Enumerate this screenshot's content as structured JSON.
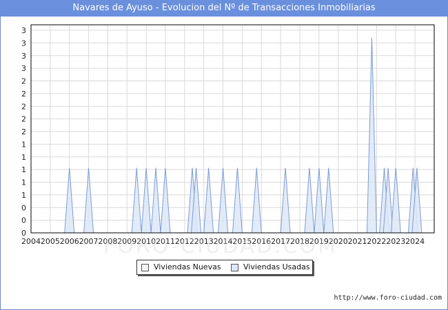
{
  "chart_data": {
    "type": "area",
    "title": "Navares de Ayuso - Evolucion del Nº de Transacciones Inmobiliarias",
    "xlabel": "",
    "ylabel": "",
    "x_tick_labels": [
      "2004",
      "2005",
      "2006",
      "2007",
      "2008",
      "2009",
      "2010",
      "2011",
      "2012",
      "2013",
      "2014",
      "2015",
      "2016",
      "2017",
      "2018",
      "2019",
      "2020",
      "2021",
      "2022",
      "2023",
      "2024"
    ],
    "y_tick_labels": [
      "0",
      "0",
      "0",
      "1",
      "1",
      "1",
      "1",
      "1",
      "2",
      "2",
      "2",
      "2",
      "2",
      "3",
      "3",
      "3",
      "3"
    ],
    "ylim": [
      0,
      3.2
    ],
    "xlim": [
      2004,
      2025
    ],
    "grid": true,
    "legend_position": "bottom",
    "colors": {
      "nuevas": "#f2f2f2",
      "usadas": "#dde7f7",
      "usadas_stroke": "#7c9bd6",
      "grid": "#d9d9d9"
    },
    "series": [
      {
        "name": "Viviendas Nuevas",
        "peaks": []
      },
      {
        "name": "Viviendas Usadas",
        "peaks": [
          {
            "x": 2006.0,
            "y": 1
          },
          {
            "x": 2007.0,
            "y": 1
          },
          {
            "x": 2009.5,
            "y": 1
          },
          {
            "x": 2010.0,
            "y": 1
          },
          {
            "x": 2010.5,
            "y": 1
          },
          {
            "x": 2011.0,
            "y": 1
          },
          {
            "x": 2012.4,
            "y": 1
          },
          {
            "x": 2012.6,
            "y": 1
          },
          {
            "x": 2013.25,
            "y": 1
          },
          {
            "x": 2014.0,
            "y": 1
          },
          {
            "x": 2014.75,
            "y": 1
          },
          {
            "x": 2015.75,
            "y": 1
          },
          {
            "x": 2017.25,
            "y": 1
          },
          {
            "x": 2018.5,
            "y": 1
          },
          {
            "x": 2019.0,
            "y": 1
          },
          {
            "x": 2019.5,
            "y": 1
          },
          {
            "x": 2021.75,
            "y": 3
          },
          {
            "x": 2022.4,
            "y": 1
          },
          {
            "x": 2022.6,
            "y": 1
          },
          {
            "x": 2023.0,
            "y": 1
          },
          {
            "x": 2023.9,
            "y": 1
          },
          {
            "x": 2024.1,
            "y": 1
          }
        ]
      }
    ]
  },
  "source": "http://www.foro-ciudad.com",
  "watermark": "FORO-CIUDAD.COM"
}
